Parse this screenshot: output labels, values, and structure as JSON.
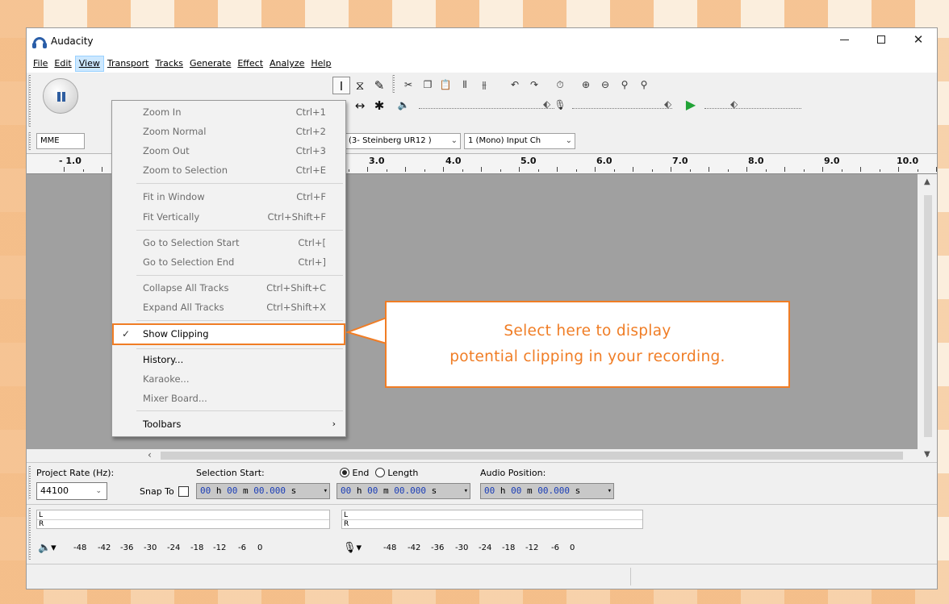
{
  "window": {
    "title": "Audacity"
  },
  "menubar": {
    "items": [
      "File",
      "Edit",
      "View",
      "Transport",
      "Tracks",
      "Generate",
      "Effect",
      "Analyze",
      "Help"
    ],
    "active": "View"
  },
  "toolbar": {
    "host": "MME",
    "recording_device": "Line (3- Steinberg UR12 )",
    "channels": "1 (Mono) Input Ch",
    "icons": [
      "pause-icon",
      "ibeam-select-icon",
      "envelope-icon",
      "draw-icon",
      "zoom-icon",
      "timeshift-icon",
      "multi-tool-icon",
      "cut-icon",
      "copy-icon",
      "paste-icon",
      "trim-icon",
      "silence-icon",
      "undo-icon",
      "redo-icon",
      "sync-lock-icon",
      "zoom-in-icon",
      "zoom-out-icon",
      "fit-selection-icon",
      "fit-project-icon",
      "speaker-icon",
      "microphone-icon",
      "play-at-speed-icon"
    ]
  },
  "ruler": {
    "labels": [
      "- 1.0",
      "3.0",
      "4.0",
      "5.0",
      "6.0",
      "7.0",
      "8.0",
      "9.0",
      "10.0"
    ]
  },
  "view_menu": {
    "items": [
      {
        "label": "Zoom In",
        "shortcut": "Ctrl+1",
        "enabled": false
      },
      {
        "label": "Zoom Normal",
        "shortcut": "Ctrl+2",
        "enabled": false
      },
      {
        "label": "Zoom Out",
        "shortcut": "Ctrl+3",
        "enabled": false
      },
      {
        "label": "Zoom to Selection",
        "shortcut": "Ctrl+E",
        "enabled": false
      },
      {
        "label": "Fit in Window",
        "shortcut": "Ctrl+F",
        "enabled": false
      },
      {
        "label": "Fit Vertically",
        "shortcut": "Ctrl+Shift+F",
        "enabled": false
      },
      {
        "label": "Go to Selection Start",
        "shortcut": "Ctrl+[",
        "enabled": false
      },
      {
        "label": "Go to Selection End",
        "shortcut": "Ctrl+]",
        "enabled": false
      },
      {
        "label": "Collapse All Tracks",
        "shortcut": "Ctrl+Shift+C",
        "enabled": false
      },
      {
        "label": "Expand All Tracks",
        "shortcut": "Ctrl+Shift+X",
        "enabled": false
      },
      {
        "label": "Show Clipping",
        "shortcut": "",
        "enabled": true,
        "checked": true
      },
      {
        "label": "History...",
        "shortcut": "",
        "enabled": true
      },
      {
        "label": "Karaoke...",
        "shortcut": "",
        "enabled": false
      },
      {
        "label": "Mixer Board...",
        "shortcut": "",
        "enabled": false
      },
      {
        "label": "Toolbars",
        "shortcut": "",
        "enabled": true,
        "submenu": true
      }
    ]
  },
  "callout": {
    "line1": "Select here to display",
    "line2": "potential clipping in your recording.",
    "color": "#f07d25"
  },
  "selection_bar": {
    "project_rate_label": "Project Rate (Hz):",
    "project_rate_value": "44100",
    "snap_to_label": "Snap To",
    "selection_start_label": "Selection Start:",
    "end_label": "End",
    "length_label": "Length",
    "audio_position_label": "Audio Position:",
    "time_hours": "00",
    "time_minutes": "00",
    "time_seconds": "00.000",
    "unit_h": "h",
    "unit_m": "m",
    "unit_s": "s"
  },
  "meters": {
    "channel_left": "L",
    "channel_right": "R",
    "scale": [
      "-48",
      "-42",
      "-36",
      "-30",
      "-24",
      "-18",
      "-12",
      "-6",
      "0"
    ]
  }
}
